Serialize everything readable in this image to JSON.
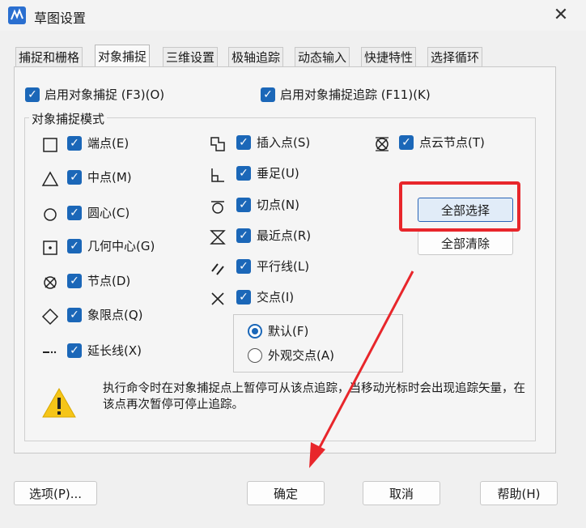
{
  "window": {
    "title": "草图设置"
  },
  "tabs": [
    "捕捉和栅格",
    "对象捕捉",
    "三维设置",
    "极轴追踪",
    "动态输入",
    "快捷特性",
    "选择循环"
  ],
  "top_options": {
    "enable_snap": "启用对象捕捉 (F3)(O)",
    "enable_tracking": "启用对象捕捉追踪 (F11)(K)"
  },
  "snap_modes": {
    "group_label": "对象捕捉模式",
    "col1": [
      "端点(E)",
      "中点(M)",
      "圆心(C)",
      "几何中心(G)",
      "节点(D)",
      "象限点(Q)",
      "延长线(X)"
    ],
    "col2": [
      "插入点(S)",
      "垂足(U)",
      "切点(N)",
      "最近点(R)",
      "平行线(L)",
      "交点(I)"
    ],
    "col3": [
      "点云节点(T)"
    ]
  },
  "intersection_mode": {
    "default": "默认(F)",
    "apparent": "外观交点(A)",
    "selected": "default"
  },
  "buttons": {
    "select_all": "全部选择",
    "clear_all": "全部清除",
    "options": "选项(P)...",
    "ok": "确定",
    "cancel": "取消",
    "help": "帮助(H)"
  },
  "info_text": "执行命令时在对象捕捉点上暂停可从该点追踪，当移动光标时会出现追踪矢量，在该点再次暂停可停止追踪。",
  "colors": {
    "accent": "#1b67b8",
    "annotation": "#e8262b"
  }
}
